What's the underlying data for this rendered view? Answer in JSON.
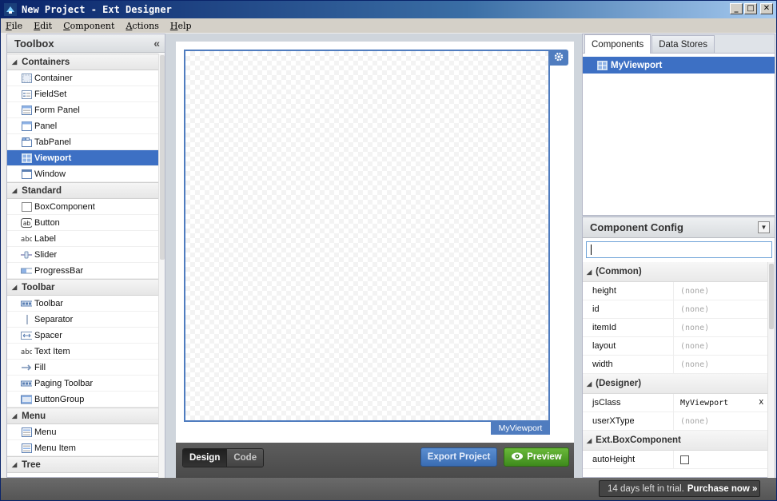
{
  "window": {
    "title": "New Project - Ext Designer",
    "minimize": "_",
    "maximize": "□",
    "close": "✕"
  },
  "menu": {
    "file": {
      "accel": "F",
      "rest": "ile"
    },
    "edit": {
      "accel": "E",
      "rest": "dit"
    },
    "component": {
      "accel": "C",
      "rest": "omponent"
    },
    "actions": {
      "accel": "A",
      "rest": "ctions"
    },
    "help": {
      "accel": "H",
      "rest": "elp"
    }
  },
  "toolbox": {
    "title": "Toolbox",
    "collapse": "«",
    "groups": [
      {
        "name": "Containers",
        "items": [
          "Container",
          "FieldSet",
          "Form Panel",
          "Panel",
          "TabPanel",
          "Viewport",
          "Window"
        ]
      },
      {
        "name": "Standard",
        "items": [
          "BoxComponent",
          "Button",
          "Label",
          "Slider",
          "ProgressBar"
        ]
      },
      {
        "name": "Toolbar",
        "items": [
          "Toolbar",
          "Separator",
          "Spacer",
          "Text Item",
          "Fill",
          "Paging Toolbar",
          "ButtonGroup"
        ]
      },
      {
        "name": "Menu",
        "items": [
          "Menu",
          "Menu Item"
        ]
      },
      {
        "name": "Tree",
        "items": []
      }
    ],
    "selected": "Viewport"
  },
  "canvas": {
    "component_tag": "MyViewport",
    "design_label": "Design",
    "code_label": "Code",
    "export_label": "Export Project",
    "preview_label": "Preview"
  },
  "components_panel": {
    "tabs": [
      "Components",
      "Data Stores"
    ],
    "tree_root": "MyViewport"
  },
  "config_panel": {
    "title": "Component Config",
    "groups": [
      {
        "name": "(Common)",
        "rows": [
          {
            "key": "height",
            "value": "(none)"
          },
          {
            "key": "id",
            "value": "(none)"
          },
          {
            "key": "itemId",
            "value": "(none)"
          },
          {
            "key": "layout",
            "value": "(none)"
          },
          {
            "key": "width",
            "value": "(none)"
          }
        ]
      },
      {
        "name": "(Designer)",
        "rows": [
          {
            "key": "jsClass",
            "value": "MyViewport",
            "set": true,
            "clear": "x"
          },
          {
            "key": "userXType",
            "value": "(none)"
          }
        ]
      },
      {
        "name": "Ext.BoxComponent",
        "rows": [
          {
            "key": "autoHeight",
            "checkbox": true
          }
        ]
      }
    ]
  },
  "status": {
    "trial_text": "14 days left in trial.",
    "purchase": "Purchase now »"
  }
}
